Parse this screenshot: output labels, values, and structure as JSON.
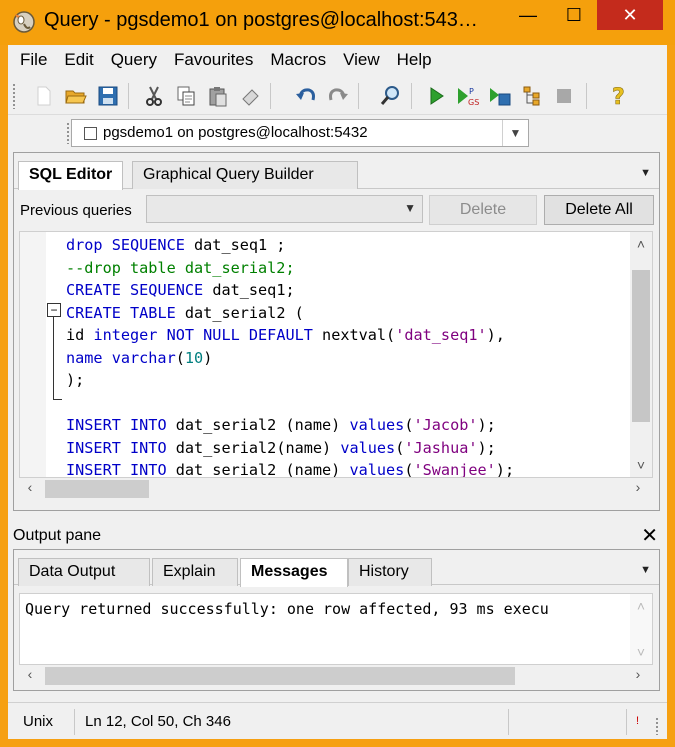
{
  "window": {
    "title": "Query - pgsdemo1 on postgres@localhost:543…",
    "minimize_glyph": "—",
    "maximize_glyph": "☐",
    "close_glyph": "✕"
  },
  "menu": [
    "File",
    "Edit",
    "Query",
    "Favourites",
    "Macros",
    "View",
    "Help"
  ],
  "toolbar": {
    "icons": [
      "new-file-icon",
      "open-folder-icon",
      "save-icon",
      "cut-icon",
      "copy-icon",
      "paste-icon",
      "clear-icon",
      "undo-icon",
      "redo-icon",
      "find-icon",
      "execute-icon",
      "execute-pgscript-icon",
      "execute-to-file-icon",
      "explain-icon",
      "cancel-query-icon",
      "help-icon"
    ]
  },
  "connection": {
    "value": "pgsdemo1 on postgres@localhost:5432"
  },
  "editor": {
    "tabs": [
      "SQL Editor",
      "Graphical Query Builder"
    ],
    "active_tab": "SQL Editor",
    "previous_queries_label": "Previous queries",
    "delete_label": "Delete",
    "delete_all_label": "Delete All",
    "lines": [
      [
        [
          "kw",
          "drop "
        ],
        [
          "kw",
          "SEQUENCE "
        ],
        [
          "id",
          "dat_seq1 ;"
        ]
      ],
      [
        [
          "cm",
          "--drop table dat_serial2;"
        ]
      ],
      [
        [
          "kw",
          "CREATE "
        ],
        [
          "kw",
          "SEQUENCE "
        ],
        [
          "id",
          "dat_seq1;"
        ]
      ],
      [
        [
          "kw",
          "CREATE "
        ],
        [
          "kw",
          "TABLE "
        ],
        [
          "id",
          "dat_serial2 ("
        ]
      ],
      [
        [
          "id",
          "id "
        ],
        [
          "kw",
          "integer "
        ],
        [
          "kw",
          "NOT NULL "
        ],
        [
          "kw",
          "DEFAULT "
        ],
        [
          "id",
          "nextval("
        ],
        [
          "st",
          "'dat_seq1'"
        ],
        [
          "id",
          "),"
        ]
      ],
      [
        [
          "kw",
          "name "
        ],
        [
          "kw",
          "varchar"
        ],
        [
          "id",
          "("
        ],
        [
          "nm",
          "10"
        ],
        [
          "id",
          ")"
        ]
      ],
      [
        [
          "id",
          ");"
        ]
      ],
      [
        [
          "id",
          ""
        ]
      ],
      [
        [
          "kw",
          "INSERT "
        ],
        [
          "kw",
          "INTO "
        ],
        [
          "id",
          "dat_serial2 (name) "
        ],
        [
          "kw",
          "values"
        ],
        [
          "id",
          "("
        ],
        [
          "st",
          "'Jacob'"
        ],
        [
          "id",
          ");"
        ]
      ],
      [
        [
          "kw",
          "INSERT "
        ],
        [
          "kw",
          "INTO "
        ],
        [
          "id",
          "dat_serial2(name) "
        ],
        [
          "kw",
          "values"
        ],
        [
          "id",
          "("
        ],
        [
          "st",
          "'Jashua'"
        ],
        [
          "id",
          ");"
        ]
      ],
      [
        [
          "kw",
          "INSERT "
        ],
        [
          "kw",
          "INTO "
        ],
        [
          "id",
          "dat_serial2 (name) "
        ],
        [
          "kw",
          "values"
        ],
        [
          "id",
          "("
        ],
        [
          "st",
          "'Swanjee'"
        ],
        [
          "id",
          ");"
        ]
      ]
    ]
  },
  "output": {
    "title": "Output pane",
    "close_glyph": "✕",
    "tabs": [
      "Data Output",
      "Explain",
      "Messages",
      "History"
    ],
    "active_tab": "Messages",
    "message": "Query returned successfully: one row affected, 93 ms execu"
  },
  "status": {
    "line_ending": "Unix",
    "position": "Ln 12, Col 50, Ch 346"
  },
  "colors": {
    "title_bar": "#f5a00c",
    "close_button": "#c42b1c",
    "keyword": "#0000c8",
    "comment": "#008000",
    "string": "#7f007f",
    "number": "#007f7f"
  }
}
